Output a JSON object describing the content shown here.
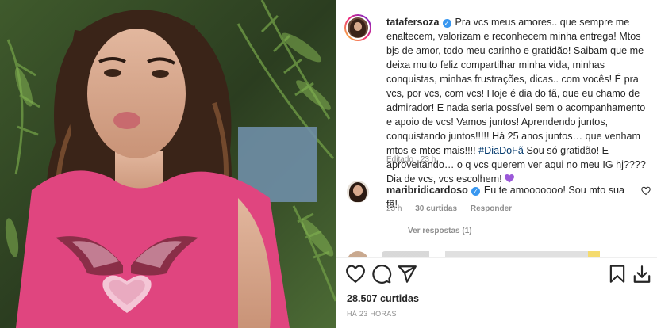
{
  "post": {
    "author": "tatafersoza",
    "caption_parts": {
      "before_hashtag": "Pra vcs meus amores.. que sempre me enaltecem, valorizam e reconhecem minha entrega! Mtos bjs de amor, todo meu carinho e gratidão! Saibam que me deixa muito feliz compartilhar minha vida, minhas conquistas, minhas frustrações, dicas.. com vocês! É pra vcs, por vcs, com vcs! Hoje é dia do fã, que eu chamo de admirador! E nada seria possível sem o acompanhamento e apoio de vcs! Vamos juntos! Aprendendo juntos, conquistando juntos!!!!! Há 25 anos juntos… que venham mtos e mtos mais!!!! ",
      "hashtag": "#DiaDoFã",
      "after_hashtag": " Sou só gratidão! E aproveitando… o q vcs querem ver aqui no meu IG hj???? Dia de vcs, vcs escolhem! "
    },
    "edited_label": "Editado",
    "edited_time": "23 h",
    "likes": "28.507 curtidas",
    "posted": "HÁ 23 HORAS"
  },
  "comment": {
    "author": "maribridicardoso",
    "text": "Eu te amooooooo! Sou mto sua fã!",
    "time": "23 h",
    "likes": "30 curtidas",
    "reply": "Responder",
    "view_replies": "Ver respostas (1)"
  },
  "colors": {
    "verified": "#3897f0",
    "hashtag": "#00376b",
    "muted": "#8e8e8e",
    "shirt": "#e0457f",
    "heart_emoji": "#9b59d9"
  },
  "icons": {
    "like": "heart-outline-icon",
    "comment": "speech-bubble-icon",
    "share": "paper-plane-icon",
    "save": "bookmark-icon",
    "download": "download-icon",
    "comment_like": "small-heart-icon",
    "verified": "verified-badge-icon"
  }
}
